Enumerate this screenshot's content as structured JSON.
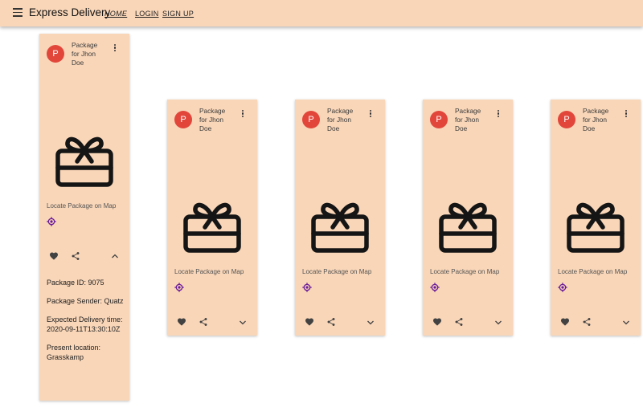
{
  "app": {
    "title": "Express Delivery",
    "nav": {
      "home": "HOME",
      "login": "LOGIN",
      "signup": "SIGN UP"
    }
  },
  "cards": [
    {
      "avatar": "P",
      "title": "Package for Jhon Doe",
      "locate_label": "Locate Package on Map",
      "expanded": true,
      "details": {
        "package_id": "Package ID: 9075",
        "sender": "Package Sender: Quatz",
        "expected_delivery": "Expected Delivery time: 2020-09-11T13:30:10Z",
        "present_location": "Present location: Grasskamp"
      }
    },
    {
      "avatar": "P",
      "title": "Package for Jhon Doe",
      "locate_label": "Locate Package on Map",
      "expanded": false
    },
    {
      "avatar": "P",
      "title": "Package for Jhon Doe",
      "locate_label": "Locate Package on Map",
      "expanded": false
    },
    {
      "avatar": "P",
      "title": "Package for Jhon Doe",
      "locate_label": "Locate Package on Map",
      "expanded": false
    },
    {
      "avatar": "P",
      "title": "Package for Jhon Doe",
      "locate_label": "Locate Package on Map",
      "expanded": false
    }
  ],
  "icons": {
    "menu": "hamburger-menu-icon",
    "more": "more-vert-icon",
    "gift": "gift-icon",
    "locate": "gps-target-icon",
    "favorite": "heart-icon",
    "share": "share-icon",
    "expand": "chevron-down-icon",
    "collapse": "chevron-up-icon"
  },
  "colors": {
    "surface": "#f9d6b8",
    "avatar": "#e2463b",
    "locate_icon": "#6a1b9a",
    "icon": "#424242"
  }
}
